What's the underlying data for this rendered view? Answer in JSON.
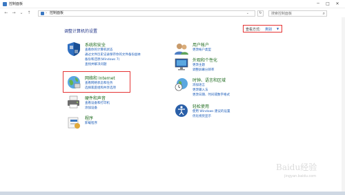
{
  "window": {
    "title": "控制面板",
    "min_glyph": "─",
    "max_glyph": "□",
    "close_glyph": "✕"
  },
  "addressbar": {
    "back_glyph": "←",
    "forward_glyph": "→",
    "recent_glyph": "⌄",
    "up_glyph": "↑",
    "crumb_sep": "›",
    "crumb": "控制面板",
    "dropdown_glyph": "⌄",
    "refresh_glyph": "↻",
    "search_placeholder": "搜索控制面板",
    "search_glyph": "⌕"
  },
  "main": {
    "heading": "调整计算机的设置",
    "view_by_label": "查看方式:",
    "view_by_value": "类别",
    "view_by_caret": "▼"
  },
  "categories": {
    "security": {
      "title": "系统和安全",
      "links": [
        "查看你的计算机状态",
        "通过文件历史记录保存你的文件备份副本",
        "备份和还原(Windows 7)",
        "查找并解决问题"
      ]
    },
    "network": {
      "title": "网络和 Internet",
      "links": [
        "查看网络状态和任务",
        "选择家庭组和共享选项"
      ]
    },
    "hardware": {
      "title": "硬件和声音",
      "links": [
        "查看设备和打印机",
        "添加设备"
      ]
    },
    "programs": {
      "title": "程序",
      "links": [
        "卸载程序"
      ]
    },
    "accounts": {
      "title": "用户帐户",
      "links": [
        "更改帐户类型"
      ]
    },
    "appearance": {
      "title": "外观和个性化",
      "links": [
        "更改主题",
        "调整屏幕分辨率"
      ]
    },
    "clock": {
      "title": "时钟、语言和区域",
      "links": [
        "添加语言",
        "更改输入法",
        "更改日期、时间或数字格式"
      ]
    },
    "ease": {
      "title": "轻松使用",
      "links": [
        "使用 Windows 建议的设置",
        "优化视觉显示"
      ]
    }
  },
  "watermark": {
    "text": "Baidu经验",
    "url": "jingyan.baidu.com"
  },
  "colors": {
    "category_title": "#1d6a1d",
    "link": "#1a5bb8",
    "heading": "#1e3287",
    "highlight_border": "#e53333"
  }
}
